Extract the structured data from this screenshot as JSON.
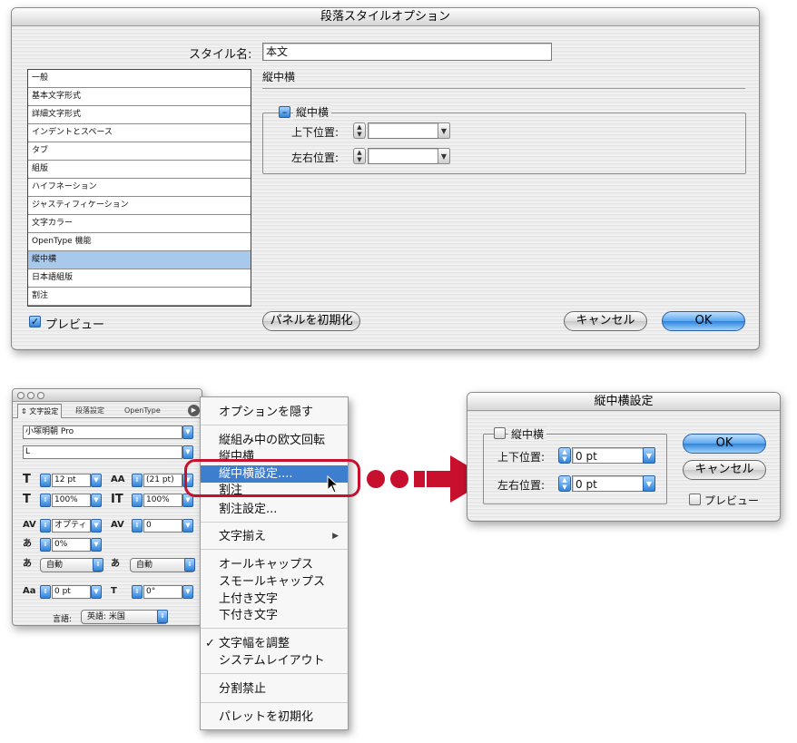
{
  "main_dialog": {
    "title": "段落スタイルオプション",
    "style_name_label": "スタイル名:",
    "style_name_value": "本文",
    "section_title": "縦中横",
    "group_label": "縦中横",
    "vertical_position_label": "上下位置:",
    "horizontal_position_label": "左右位置:",
    "categories": [
      "一般",
      "基本文字形式",
      "詳細文字形式",
      "インデントとスペース",
      "タブ",
      "組版",
      "ハイフネーション",
      "ジャスティフィケーション",
      "文字カラー",
      "OpenType 機能",
      "縦中横",
      "日本語組版",
      "割注"
    ],
    "selected_category": "縦中横",
    "preview_label": "プレビュー",
    "reset_panel_label": "パネルを初期化",
    "cancel_label": "キャンセル",
    "ok_label": "OK"
  },
  "character_palette": {
    "tabs": [
      "文字設定",
      "段落設定",
      "OpenType"
    ],
    "font_family": "小塚明朝 Pro",
    "font_style": "L",
    "font_size": "12 pt",
    "leading": "(21 pt)",
    "vertical_scale": "100%",
    "horizontal_scale": "100%",
    "kerning": "オプティ",
    "tracking": "0",
    "tsume": "0%",
    "aki_before": "自動",
    "aki_after": "自動",
    "baseline_shift": "0 pt",
    "rotation": "0°",
    "language_label": "言語:",
    "language_value": "英語: 米国"
  },
  "flyout_menu": {
    "items": [
      "オプションを隠す",
      "縦組み中の欧文回転",
      "縦中横",
      "縦中横設定....",
      "割注",
      "割注設定...",
      "文字揃え",
      "オールキャップス",
      "スモールキャップス",
      "上付き文字",
      "下付き文字",
      "文字幅を調整",
      "システムレイアウト",
      "分割禁止",
      "パレットを初期化"
    ],
    "highlighted": "縦中横設定....",
    "checked": "文字幅を調整",
    "submenu_item": "文字揃え"
  },
  "tatechuyoko_dialog": {
    "title": "縦中横設定",
    "checkbox_label": "縦中横",
    "vertical_position_label": "上下位置:",
    "vertical_position_value": "0 pt",
    "horizontal_position_label": "左右位置:",
    "horizontal_position_value": "0 pt",
    "ok_label": "OK",
    "cancel_label": "キャンセル",
    "preview_label": "プレビュー"
  },
  "colors": {
    "accent_red": "#c8102e",
    "aqua_blue": "#2f84da",
    "selection_blue": "#a9c9ec",
    "menu_highlight": "#3d7ece"
  }
}
